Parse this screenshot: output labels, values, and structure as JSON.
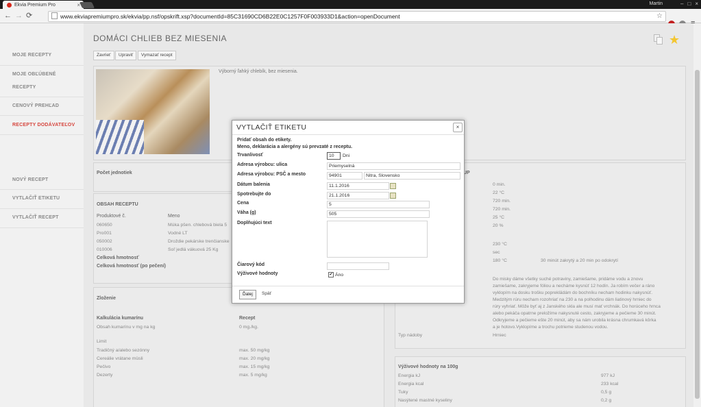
{
  "browser": {
    "tab_title": "Ekvia Premium Pro",
    "tab_close": "×",
    "user": "Martin",
    "url": "www.ekviapremiumpro.sk/ekvia/pp.nsf/opskrift.xsp?documentId=85C31690CD6B22E0C1257F0F003933D1&action=openDocument",
    "back": "←",
    "forward": "→",
    "reload": "⟳",
    "menu": "≡",
    "win_min": "–",
    "win_max": "□",
    "win_close": "×"
  },
  "sidebar": {
    "items": [
      {
        "label": "MOJE RECEPTY"
      },
      {
        "label": "MOJE OBĽÚBENÉ RECEPTY"
      },
      {
        "label": "CENOVÝ PREHĽAD"
      },
      {
        "label": "RECEPTY DODÁVATEĽOV"
      },
      {
        "label": "NOVÝ RECEPT"
      },
      {
        "label": "VYTLAČIŤ ETIKETU"
      },
      {
        "label": "VYTLAČIŤ RECEPT"
      }
    ]
  },
  "recipe": {
    "title": "DOMÁCI CHLIEB BEZ MIESENIA",
    "buttons": {
      "close": "Zavrieť",
      "edit": "Upraviť",
      "delete": "Vymazať recept"
    },
    "description": "Výborný ľahký chlebík, bez miesenia.",
    "units_label": "Počet jednotiek",
    "contents": {
      "heading": "OBSAH RECEPTU",
      "col_product": "Produktové č.",
      "col_name": "Meno",
      "rows": [
        {
          "code": "060650",
          "name": "Múka pšen. chlebová biela 5"
        },
        {
          "code": "Pro001",
          "name": "Vodné  LT"
        },
        {
          "code": "050002",
          "name": "Droždie pekárske trenčianske"
        },
        {
          "code": "010006",
          "name": "Soľ jedlá vákuová 25 Kg"
        }
      ],
      "total_weight": "Celková hmotnosť",
      "total_weight_baked": "Celková hmotnosť (po pečení)"
    },
    "composition": {
      "heading": "Zloženie",
      "coumarin_calc": "Kalkulácia kumarínu",
      "recipe_label": "Recept",
      "coumarin_content": "Obsah kumarínu v mg na kg",
      "coumarin_value": "0 mg./kg.",
      "limit": "Limit",
      "limits": [
        {
          "label": "Tradičný a/alebo sezónny",
          "value": "max. 50 mg/kg"
        },
        {
          "label": "Cereálie vrátane müsli",
          "value": "max. 20 mg/kg"
        },
        {
          "label": "Pečivo",
          "value": "max. 15 mg/kg"
        },
        {
          "label": "Dezerty",
          "value": "max. 5 mg/kg"
        }
      ]
    },
    "process": {
      "heading_fragment": "UP",
      "values": [
        "0 min.",
        "22 °C",
        "720 min.",
        "720 min.",
        "25 °C",
        "20 %",
        "230 °C",
        "sec",
        "180 °C"
      ],
      "note": "30 minút zakrytý a 20 min po odokrytí",
      "text": [
        "Do misky dáme všetky suché potraviny, zamiešame, pridáme vodu a znovu",
        "zamiešame, zakryjeme fóliou a necháme kysnúť 12 hodín. Ja robím večer a ráno",
        "vyklopím na dosku trošku popreklädám do bochníku necham hodinku nakysnúť.",
        "Medzitým rúru necham rozohriať na 230 a na polhodinu dám liatinový hrniec do",
        "rúry vyhriať. Môže byť aj z Janského skla ale musí mať vrchnák. Do horúceho hrnca",
        "alebo pekáča opatrne preložíme nakysnuté cesto, zakryjeme a pečieme 30 minút.",
        "Odkryjeme a pečieme ešte 20 minút, aby sa nám urobila krásna chrumkavá kôrka",
        "a je hotovo.Vyklopíme a trochu potrieme studenou vodou."
      ],
      "vessel_label": "Typ nádoby",
      "vessel_value": "Hrniec"
    },
    "nutrition": {
      "heading": "Výživové hodnoty na 100g",
      "rows": [
        {
          "label": "Energia kJ",
          "value": "977 kJ"
        },
        {
          "label": "Energia kcal",
          "value": "233 kcal"
        },
        {
          "label": "Tuky",
          "value": "0,5 g"
        }
      ],
      "partial_row": "Nasýtené mastné kyseliny",
      "partial_value": "0,2 g"
    }
  },
  "modal": {
    "title": "VYTLAČIŤ ETIKETU",
    "close": "×",
    "intro1": "Pridať obsah do etikety.",
    "intro2": "Meno, deklarácia a alergény sú prevzaté z receptu.",
    "fields": {
      "shelf_life_label": "Trvanlivosť",
      "shelf_life_value": "10",
      "shelf_life_unit": "Dni",
      "street_label": "Adresa výrobcu: ulica",
      "street_value": "Priemyselná",
      "zip_label": "Adresa výrobcu: PSČ a mesto",
      "zip_value": "94901",
      "city_value": "Nitra, Slovensko",
      "pack_date_label": "Dátum balenia",
      "pack_date_value": "11.1.2016",
      "best_before_label": "Spotrebujte do",
      "best_before_value": "21.1.2016",
      "price_label": "Cena",
      "price_value": "5",
      "weight_label": "Váha (g)",
      "weight_value": "505",
      "extra_text_label": "Doplňujúci text",
      "barcode_label": "Čiarový kód",
      "nutrition_label": "Výživové hodnoty",
      "nutrition_check": "✔",
      "nutrition_yes": "Áno"
    },
    "next": "Ďalej",
    "back": "Späť"
  }
}
